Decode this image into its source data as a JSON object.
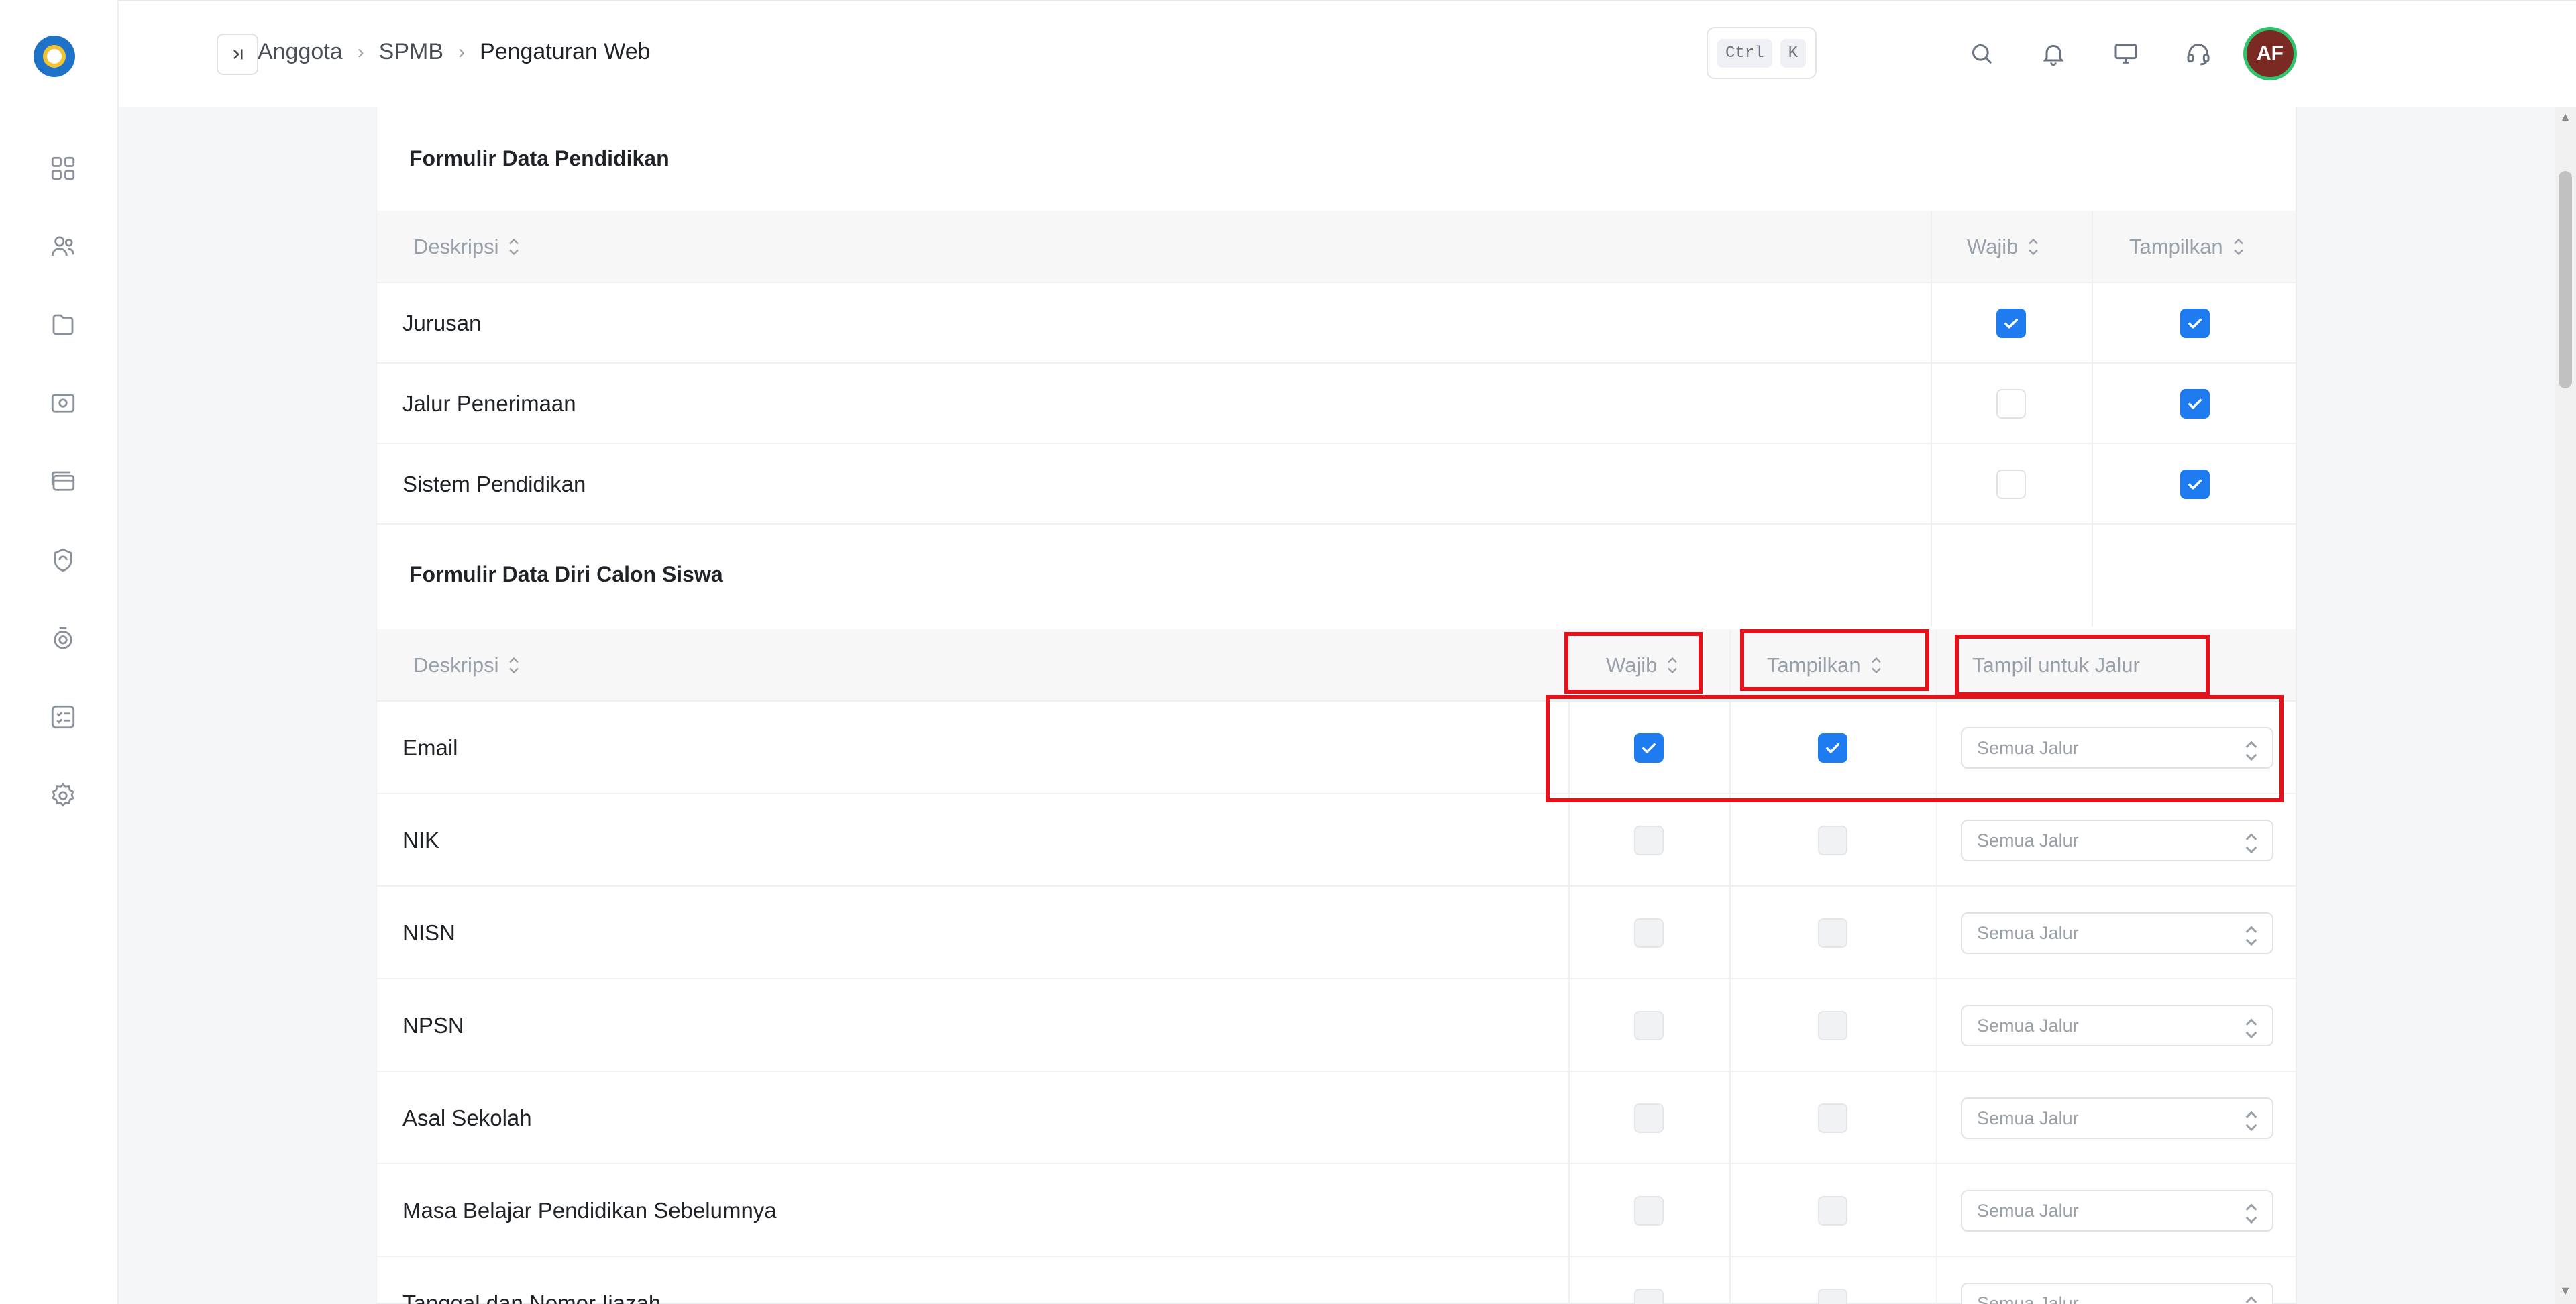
{
  "breadcrumb": {
    "items": [
      "Anggota",
      "SPMB"
    ],
    "current": "Pengaturan Web"
  },
  "header": {
    "shortcut_keys": [
      "Ctrl",
      "K"
    ],
    "avatar_initials": "AF"
  },
  "sidebar": {
    "items": [
      "dashboard-icon",
      "users-icon",
      "folder-icon",
      "wallet-icon",
      "card-icon",
      "shield-icon",
      "badge-icon",
      "checklist-icon",
      "gear-icon"
    ]
  },
  "section_pendidikan": {
    "title": "Formulir Data Pendidikan",
    "col_desc": "Deskripsi",
    "col_wajib": "Wajib",
    "col_tampilkan": "Tampilkan",
    "rows": [
      {
        "label": "Jurusan",
        "wajib": true,
        "tampilkan": true
      },
      {
        "label": "Jalur Penerimaan",
        "wajib": false,
        "tampilkan": true
      },
      {
        "label": "Sistem Pendidikan",
        "wajib": false,
        "tampilkan": true
      }
    ]
  },
  "section_diri": {
    "title": "Formulir Data Diri Calon Siswa",
    "col_desc": "Deskripsi",
    "col_wajib": "Wajib",
    "col_tampilkan": "Tampilkan",
    "col_jalur": "Tampil untuk Jalur",
    "rows": [
      {
        "label": "Email",
        "wajib": true,
        "tampilkan": true,
        "jalur": "Semua Jalur"
      },
      {
        "label": "NIK",
        "wajib": false,
        "tampilkan": false,
        "jalur": "Semua Jalur"
      },
      {
        "label": "NISN",
        "wajib": false,
        "tampilkan": false,
        "jalur": "Semua Jalur"
      },
      {
        "label": "NPSN",
        "wajib": false,
        "tampilkan": false,
        "jalur": "Semua Jalur"
      },
      {
        "label": "Asal Sekolah",
        "wajib": false,
        "tampilkan": false,
        "jalur": "Semua Jalur"
      },
      {
        "label": "Masa Belajar Pendidikan Sebelumnya",
        "wajib": false,
        "tampilkan": false,
        "jalur": "Semua Jalur"
      },
      {
        "label": "Tanggal dan Nomor Ijazah",
        "wajib": false,
        "tampilkan": false,
        "jalur": "Semua Jalur"
      }
    ]
  },
  "colors": {
    "accent": "#1f7cf0",
    "highlight": "#e3131c",
    "avatar_ring": "#2fc36b",
    "avatar_bg": "#7a2a22"
  }
}
